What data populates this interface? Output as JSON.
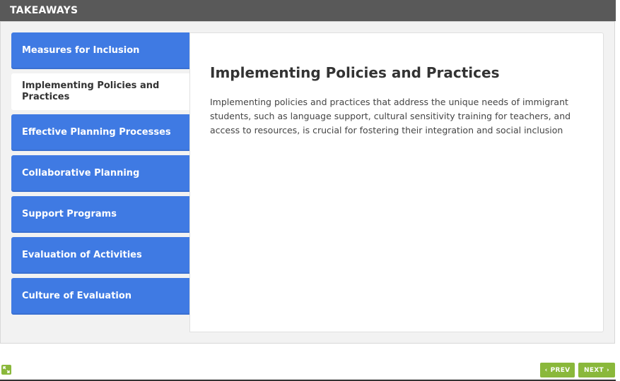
{
  "header": {
    "title": "TAKEAWAYS"
  },
  "tabs": [
    {
      "label": "Measures for Inclusion"
    },
    {
      "label": "Implementing Policies and Practices",
      "active": true
    },
    {
      "label": "Effective Planning Processes"
    },
    {
      "label": "Collaborative Planning"
    },
    {
      "label": "Support Programs"
    },
    {
      "label": "Evaluation of Activities"
    },
    {
      "label": "Culture of Evaluation"
    }
  ],
  "content": {
    "title": "Implementing Policies and Practices",
    "body": "Implementing policies and practices that address the unique needs of immigrant students, such as language support, cultural sensitivity training for teachers, and access to resources, is crucial for fostering their integration and social inclusion"
  },
  "nav": {
    "prev_label": "PREV",
    "next_label": "NEXT",
    "prev_icon": "chevron-left-icon",
    "next_icon": "chevron-right-icon",
    "expand_icon": "expand-icon"
  },
  "colors": {
    "header_bg": "#595959",
    "tab_bg": "#3f7ae3",
    "nav_bg": "#8ab83b"
  }
}
